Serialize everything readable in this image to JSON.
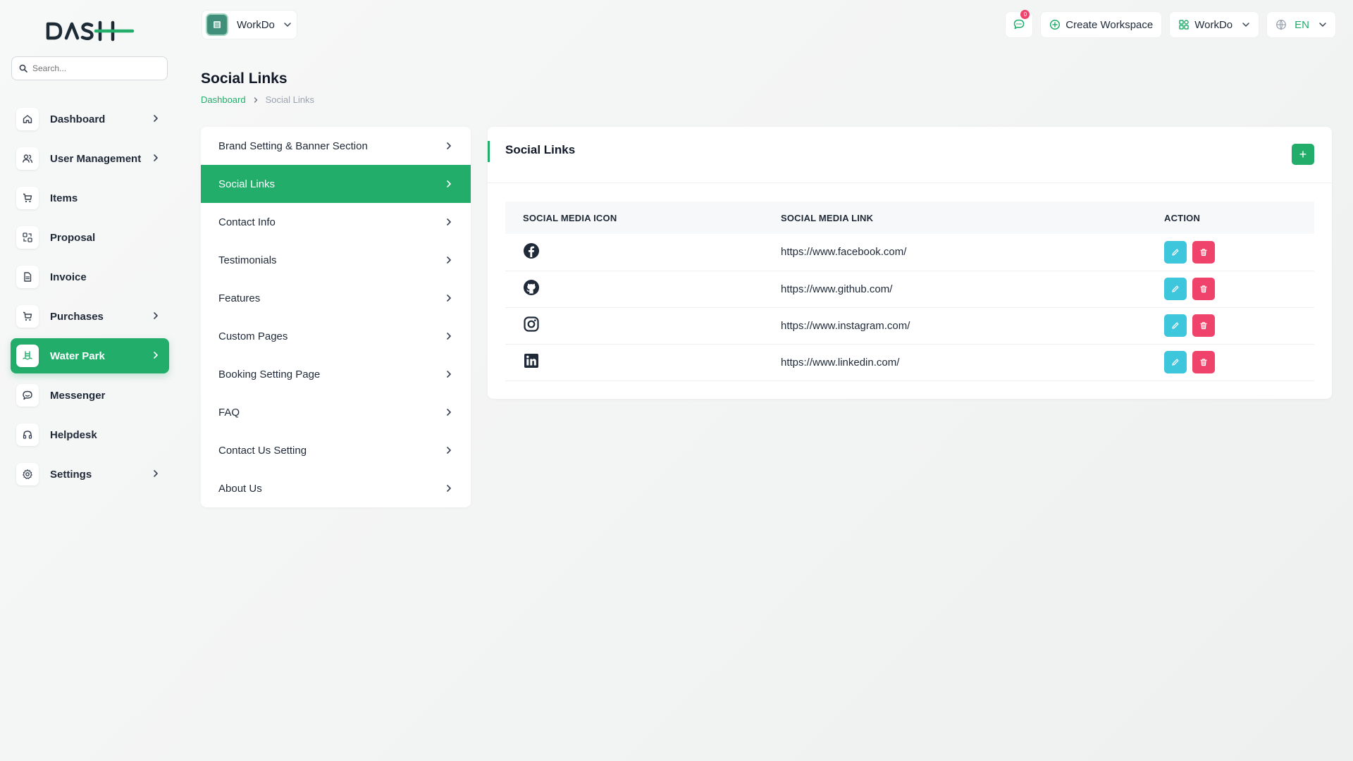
{
  "brand": {
    "logo_text": "DASH",
    "accent": "#22ad6b"
  },
  "sidebar": {
    "search_placeholder": "Search...",
    "items": [
      {
        "label": "Dashboard",
        "icon": "home-icon",
        "has_children": true,
        "active": false
      },
      {
        "label": "User Management",
        "icon": "users-icon",
        "has_children": true,
        "active": false
      },
      {
        "label": "Items",
        "icon": "cart-icon",
        "has_children": false,
        "active": false
      },
      {
        "label": "Proposal",
        "icon": "proposal-icon",
        "has_children": false,
        "active": false
      },
      {
        "label": "Invoice",
        "icon": "file-icon",
        "has_children": false,
        "active": false
      },
      {
        "label": "Purchases",
        "icon": "cart-icon",
        "has_children": true,
        "active": false
      },
      {
        "label": "Water Park",
        "icon": "pool-icon",
        "has_children": true,
        "active": true
      },
      {
        "label": "Messenger",
        "icon": "chat-icon",
        "has_children": false,
        "active": false
      },
      {
        "label": "Helpdesk",
        "icon": "headset-icon",
        "has_children": false,
        "active": false
      },
      {
        "label": "Settings",
        "icon": "gear-icon",
        "has_children": true,
        "active": false
      }
    ]
  },
  "topbar": {
    "workspace_name": "WorkDo",
    "message_count": "0",
    "create_workspace": "Create Workspace",
    "workspace_menu": "WorkDo",
    "language": "EN"
  },
  "page": {
    "title": "Social Links",
    "breadcrumb": {
      "home": "Dashboard",
      "current": "Social Links"
    }
  },
  "settings_menu": [
    {
      "label": "Brand Setting & Banner Section",
      "active": false
    },
    {
      "label": "Social Links",
      "active": true
    },
    {
      "label": "Contact Info",
      "active": false
    },
    {
      "label": "Testimonials",
      "active": false
    },
    {
      "label": "Features",
      "active": false
    },
    {
      "label": "Custom Pages",
      "active": false
    },
    {
      "label": "Booking Setting Page",
      "active": false
    },
    {
      "label": "FAQ",
      "active": false
    },
    {
      "label": "Contact Us Setting",
      "active": false
    },
    {
      "label": "About Us",
      "active": false
    }
  ],
  "card": {
    "title": "Social Links",
    "add_label": "+",
    "columns": [
      "SOCIAL MEDIA ICON",
      "SOCIAL MEDIA LINK",
      "ACTION"
    ],
    "rows": [
      {
        "icon": "facebook-icon",
        "link": "https://www.facebook.com/"
      },
      {
        "icon": "github-icon",
        "link": "https://www.github.com/"
      },
      {
        "icon": "instagram-icon",
        "link": "https://www.instagram.com/"
      },
      {
        "icon": "linkedin-icon",
        "link": "https://www.linkedin.com/"
      }
    ]
  }
}
